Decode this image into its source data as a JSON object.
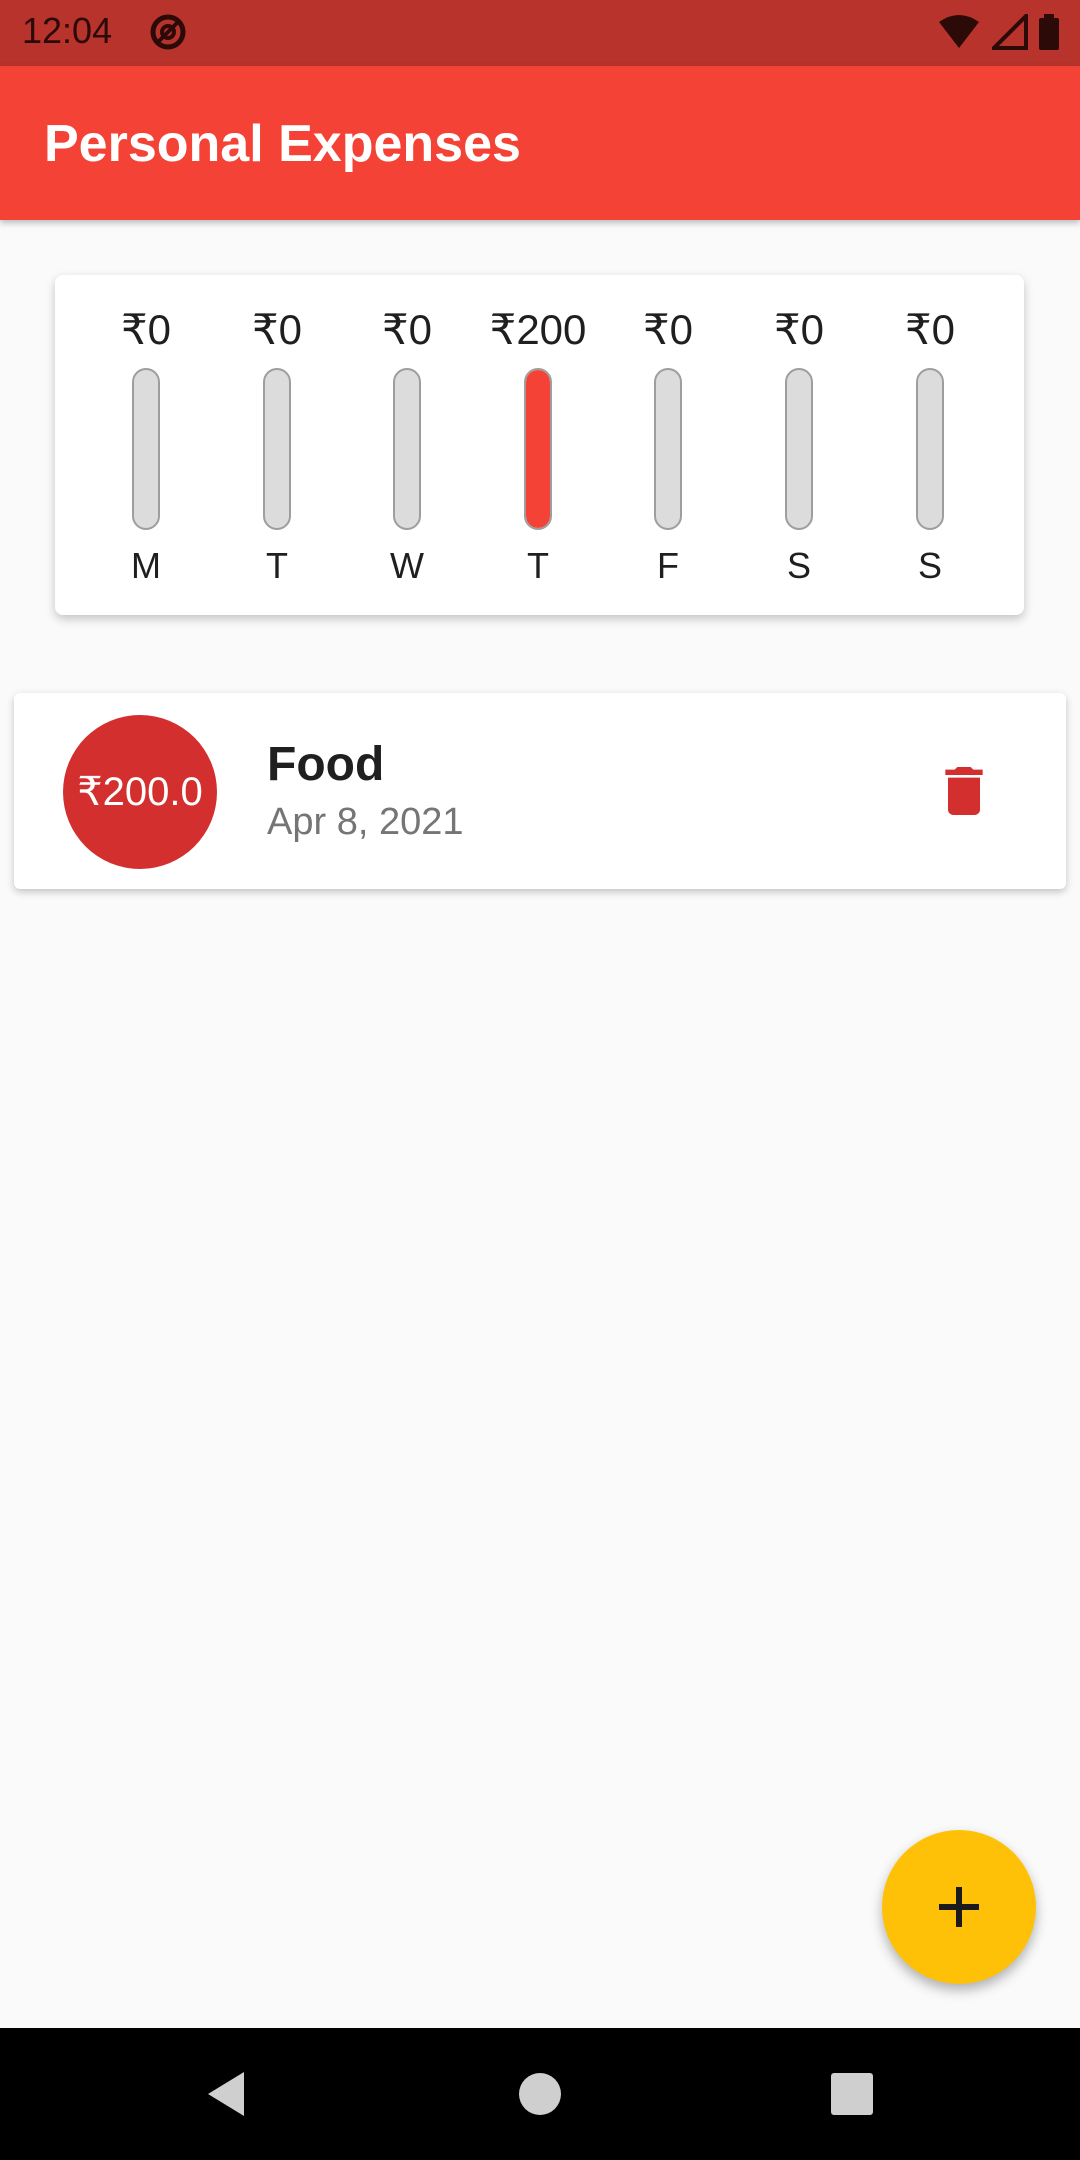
{
  "status_bar": {
    "time": "12:04",
    "icons": [
      "at-sign-icon",
      "wifi-icon",
      "signal-icon",
      "battery-icon"
    ]
  },
  "app_bar": {
    "title": "Personal Expenses"
  },
  "chart": {
    "fill_color": "#f44336",
    "track_color": "#dcdcdc",
    "days": [
      {
        "letter": "M",
        "amount": "₹0",
        "fraction": 0
      },
      {
        "letter": "T",
        "amount": "₹0",
        "fraction": 0
      },
      {
        "letter": "W",
        "amount": "₹0",
        "fraction": 0
      },
      {
        "letter": "T",
        "amount": "₹200",
        "fraction": 1
      },
      {
        "letter": "F",
        "amount": "₹0",
        "fraction": 0
      },
      {
        "letter": "S",
        "amount": "₹0",
        "fraction": 0
      },
      {
        "letter": "S",
        "amount": "₹0",
        "fraction": 0
      }
    ]
  },
  "transactions": [
    {
      "amount": "₹200.0",
      "title": "Food",
      "date": "Apr 8, 2021",
      "avatar_color": "#d32f2f",
      "delete_icon": "trash-icon"
    }
  ],
  "fab": {
    "icon": "plus-icon",
    "color": "#ffc107"
  },
  "nav_bar": {
    "icons": [
      "back-icon",
      "home-icon",
      "recents-icon"
    ]
  }
}
